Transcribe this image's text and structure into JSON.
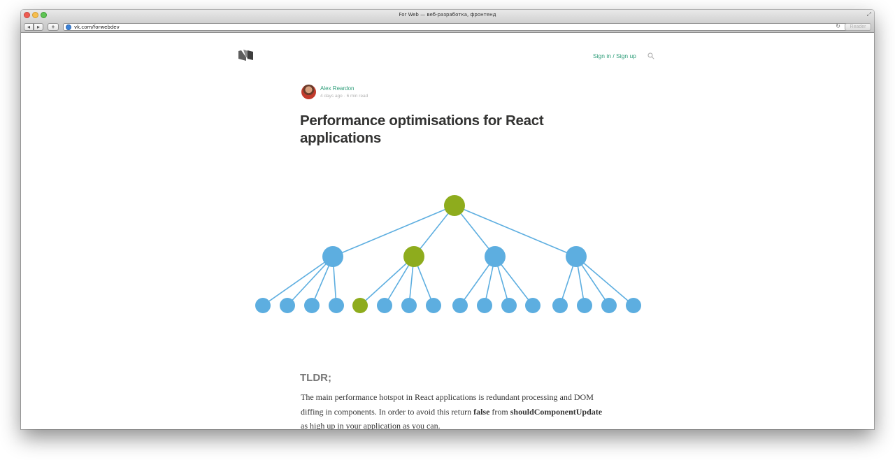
{
  "browser": {
    "window_title": "For Web — веб-разработка, фронтенд",
    "url": "vk.com/forwebdev",
    "reader_label": "Reader",
    "back_glyph": "◂",
    "forward_glyph": "▸",
    "add_glyph": "+",
    "reload_glyph": "↻",
    "fullscreen_glyph": "⤢"
  },
  "site": {
    "signin_label": "Sign in / Sign up",
    "logo_icon": "medium-logo-icon",
    "search_icon": "search-icon"
  },
  "article": {
    "author": "Alex Reardon",
    "meta": "4 days ago · 6 min read",
    "title": "Performance optimisations for React applications",
    "section_heading": "TLDR;",
    "paragraph": {
      "part1": "The main performance hotspot in React applications is redundant processing and DOM diffing in components. In order to avoid this return ",
      "bold1": "false",
      "part2": " from ",
      "bold2": "shouldComponentUpdate",
      "part3": " as high up in your application as you can."
    }
  },
  "diagram": {
    "colors": {
      "node": "#5daee0",
      "highlight": "#8eac1d",
      "edge": "#5daee0"
    },
    "root": {
      "highlighted": true
    },
    "children": [
      {
        "highlighted": false,
        "leaves": [
          false,
          false,
          false,
          false
        ]
      },
      {
        "highlighted": true,
        "leaves": [
          true,
          false,
          false,
          false
        ]
      },
      {
        "highlighted": false,
        "leaves": [
          false,
          false,
          false,
          false
        ]
      },
      {
        "highlighted": false,
        "leaves": [
          false,
          false,
          false,
          false
        ]
      }
    ]
  }
}
